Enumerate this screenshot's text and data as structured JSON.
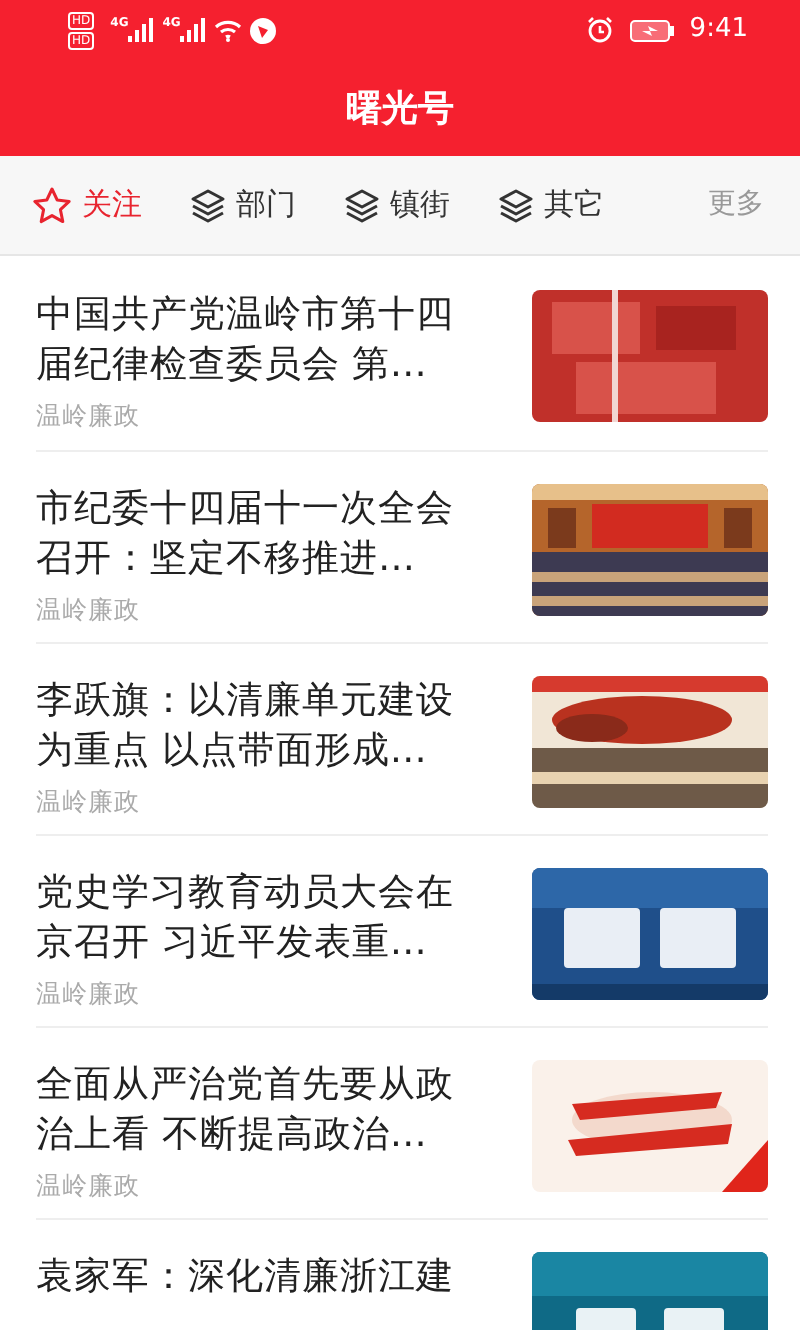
{
  "status_bar": {
    "hd_labels": [
      "HD",
      "HD"
    ],
    "network_labels": [
      "4G",
      "4G"
    ],
    "time": "9:41"
  },
  "header": {
    "title": "曙光号"
  },
  "tabs": [
    {
      "label": "关注",
      "kind": "star",
      "selected": true
    },
    {
      "label": "部门",
      "kind": "layers",
      "selected": false
    },
    {
      "label": "镇街",
      "kind": "layers",
      "selected": false
    },
    {
      "label": "其它",
      "kind": "layers",
      "selected": false
    }
  ],
  "more": "更多",
  "articles": [
    {
      "title": "中国共产党温岭市第十四届纪律检查委员会 第…",
      "source": "温岭廉政"
    },
    {
      "title": "市纪委十四届十一次全会召开：坚定不移推进…",
      "source": "温岭廉政"
    },
    {
      "title": "李跃旗：以清廉单元建设为重点 以点带面形成…",
      "source": "温岭廉政"
    },
    {
      "title": "党史学习教育动员大会在京召开 习近平发表重…",
      "source": "温岭廉政"
    },
    {
      "title": "全面从严治党首先要从政治上看 不断提高政治…",
      "source": "温岭廉政"
    },
    {
      "title": "袁家军：深化清廉浙江建"
    }
  ]
}
